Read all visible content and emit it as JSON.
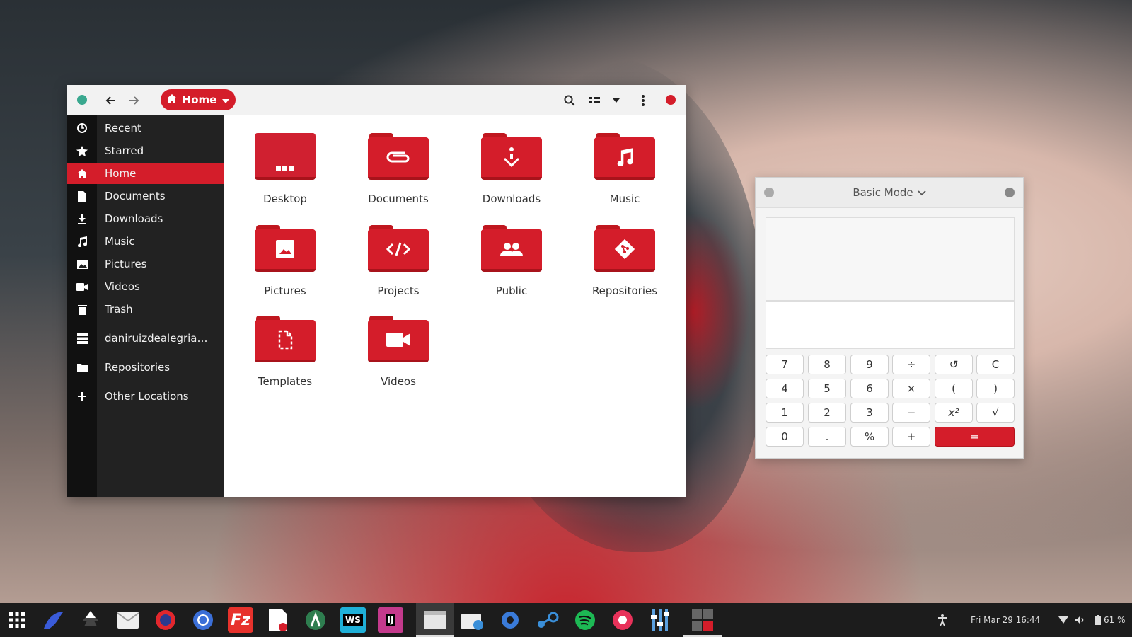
{
  "files": {
    "path_button": "Home",
    "sidebar": [
      {
        "label": "Recent",
        "icon": "clock-icon"
      },
      {
        "label": "Starred",
        "icon": "star-icon"
      },
      {
        "label": "Home",
        "icon": "home-icon",
        "active": true
      },
      {
        "label": "Documents",
        "icon": "document-icon"
      },
      {
        "label": "Downloads",
        "icon": "download-icon"
      },
      {
        "label": "Music",
        "icon": "music-icon"
      },
      {
        "label": "Pictures",
        "icon": "picture-icon"
      },
      {
        "label": "Videos",
        "icon": "video-icon"
      },
      {
        "label": "Trash",
        "icon": "trash-icon"
      },
      {
        "label": "daniruizdealegria@...",
        "icon": "server-icon"
      },
      {
        "label": "Repositories",
        "icon": "folder-icon"
      },
      {
        "label": "Other Locations",
        "icon": "plus-icon"
      }
    ],
    "items": [
      {
        "label": "Desktop",
        "icon": "desktop-folder-icon"
      },
      {
        "label": "Documents",
        "icon": "documents-folder-icon"
      },
      {
        "label": "Downloads",
        "icon": "downloads-folder-icon"
      },
      {
        "label": "Music",
        "icon": "music-folder-icon"
      },
      {
        "label": "Pictures",
        "icon": "pictures-folder-icon"
      },
      {
        "label": "Projects",
        "icon": "projects-folder-icon"
      },
      {
        "label": "Public",
        "icon": "public-folder-icon"
      },
      {
        "label": "Repositories",
        "icon": "repositories-folder-icon"
      },
      {
        "label": "Templates",
        "icon": "templates-folder-icon"
      },
      {
        "label": "Videos",
        "icon": "videos-folder-icon"
      }
    ]
  },
  "calculator": {
    "mode": "Basic Mode",
    "keys": [
      [
        "7",
        "8",
        "9",
        "÷",
        "↺",
        "C"
      ],
      [
        "4",
        "5",
        "6",
        "×",
        "(",
        ")"
      ],
      [
        "1",
        "2",
        "3",
        "−",
        "x²",
        "√"
      ],
      [
        "0",
        ".",
        "%",
        "+",
        "="
      ]
    ]
  },
  "taskbar": {
    "clock": "Fri Mar 29  16:44",
    "battery": "61 %",
    "apps": [
      "app-grid-icon",
      "kde-connect-icon",
      "inkscape-icon",
      "mail-icon",
      "firefox-icon",
      "chromium-icon",
      "filezilla-icon",
      "text-editor-icon",
      "android-studio-icon",
      "webstorm-icon",
      "intellij-icon",
      "files-icon",
      "software-center-icon",
      "settings-icon",
      "steam-icon",
      "spotify-icon",
      "fragments-icon",
      "mixer-icon",
      "calculator-icon"
    ]
  },
  "colors": {
    "accent": "#d41d2a",
    "sidebar_bg": "#222222",
    "taskbar_bg": "#1c1c1c"
  }
}
